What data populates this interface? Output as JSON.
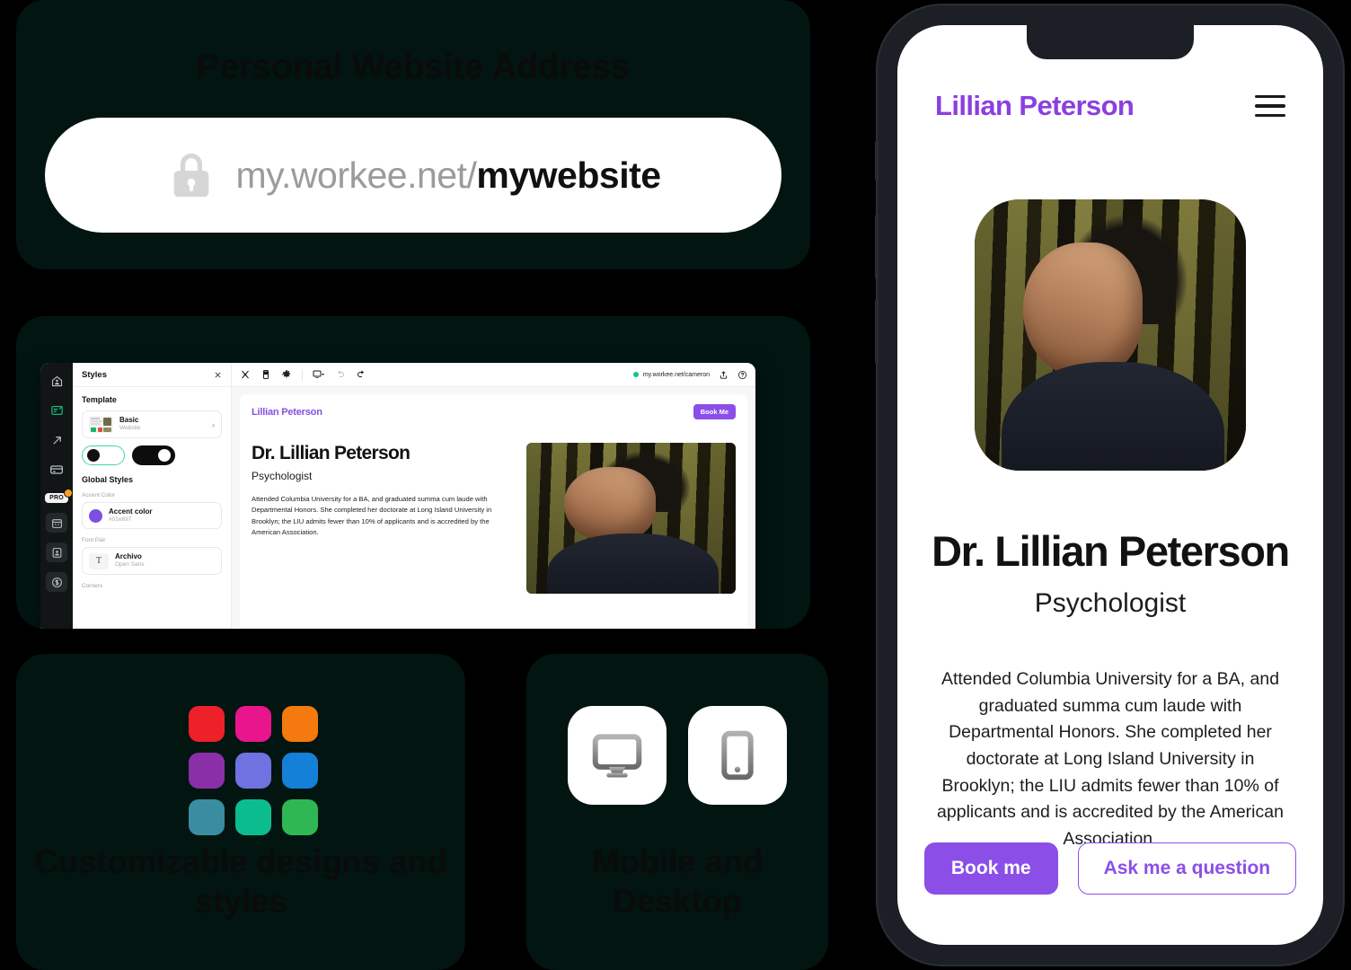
{
  "cards": {
    "url": {
      "title": "Personal Website Address",
      "lock_icon": "lock-icon",
      "host": "my.workee.net/",
      "slug": "mywebsite"
    },
    "colors": {
      "title": "Customizable designs and styles",
      "swatches": [
        "#ee2029",
        "#e9158c",
        "#f4790e",
        "#8b2fa8",
        "#6f72e0",
        "#1580d8",
        "#3a8ca0",
        "#0bbd8e",
        "#2fb754"
      ]
    },
    "devices": {
      "title": "Mobile and Desktop",
      "items": [
        {
          "name": "desktop-icon",
          "label": "Desktop"
        },
        {
          "name": "mobile-icon",
          "label": "Mobile"
        }
      ]
    }
  },
  "editor": {
    "rail": [
      {
        "name": "sidebar-item-home",
        "icon": "home-icon",
        "active": false
      },
      {
        "name": "sidebar-item-editor",
        "icon": "edit-screen-icon",
        "active": true
      },
      {
        "name": "sidebar-item-share",
        "icon": "arrow-out-icon",
        "active": false
      },
      {
        "name": "sidebar-item-payments",
        "icon": "card-icon",
        "active": false
      },
      {
        "name": "sidebar-item-pro",
        "icon": "pro-badge",
        "label": "PRO",
        "active": false
      },
      {
        "name": "sidebar-item-calendar",
        "icon": "calendar-icon",
        "active": false
      },
      {
        "name": "sidebar-item-clients",
        "icon": "contact-icon",
        "active": false
      },
      {
        "name": "sidebar-item-earnings",
        "icon": "dollar-icon",
        "active": false
      }
    ],
    "panel": {
      "title": "Styles",
      "close_icon": "close-icon",
      "template_label": "Template",
      "template": {
        "name": "Basic",
        "type": "Website",
        "chevron": "chevron-right-icon"
      },
      "mode": {
        "light_selected": true
      },
      "global_styles_label": "Global Styles",
      "accent_label": "Accent Color",
      "accent": {
        "name": "Accent color",
        "hex": "#01e697",
        "swatch": "#7b4fe0"
      },
      "font_pair_label": "Font Pair",
      "font_pair": {
        "primary": "Archivo",
        "secondary": "Open Sans",
        "icon": "text-icon"
      },
      "corners_label": "Corners"
    },
    "toolbar": {
      "icons": [
        "widgets-icon",
        "mobile-preview-icon",
        "settings-icon",
        "device-select-icon",
        "undo-icon",
        "redo-icon"
      ],
      "status_dot_color": "#12c87d",
      "url": "my.workee.net/cameron",
      "share_icon": "share-icon",
      "help_icon": "help-icon"
    },
    "page": {
      "brand": "Lillian Peterson",
      "book_button": "Book Me",
      "heading": "Dr. Lillian Peterson",
      "subheading": "Psychologist",
      "bio": "Attended Columbia University for a BA, and graduated summa cum laude with Departmental Honors. She completed her doctorate at Long Island University in Brooklyn; the LIU admits fewer than 10% of applicants and is accredited by the American Association.",
      "photo_alt": "portrait-photo"
    }
  },
  "phone": {
    "brand": "Lillian Peterson",
    "menu_icon": "hamburger-menu-icon",
    "photo_alt": "portrait-photo",
    "heading": "Dr. Lillian Peterson",
    "subheading": "Psychologist",
    "bio": "Attended Columbia University for a BA, and graduated summa cum laude with Departmental Honors. She completed her doctorate at Long Island University in Brooklyn; the LIU admits fewer than 10% of applicants and is accredited by the American Association.",
    "primary_button": "Book me",
    "secondary_button": "Ask me a question"
  },
  "colors": {
    "accent_purple": "#8b4fe8",
    "accent_green": "#12c87d",
    "card_bg": "#021511",
    "phone_frame": "#1d1f26"
  }
}
